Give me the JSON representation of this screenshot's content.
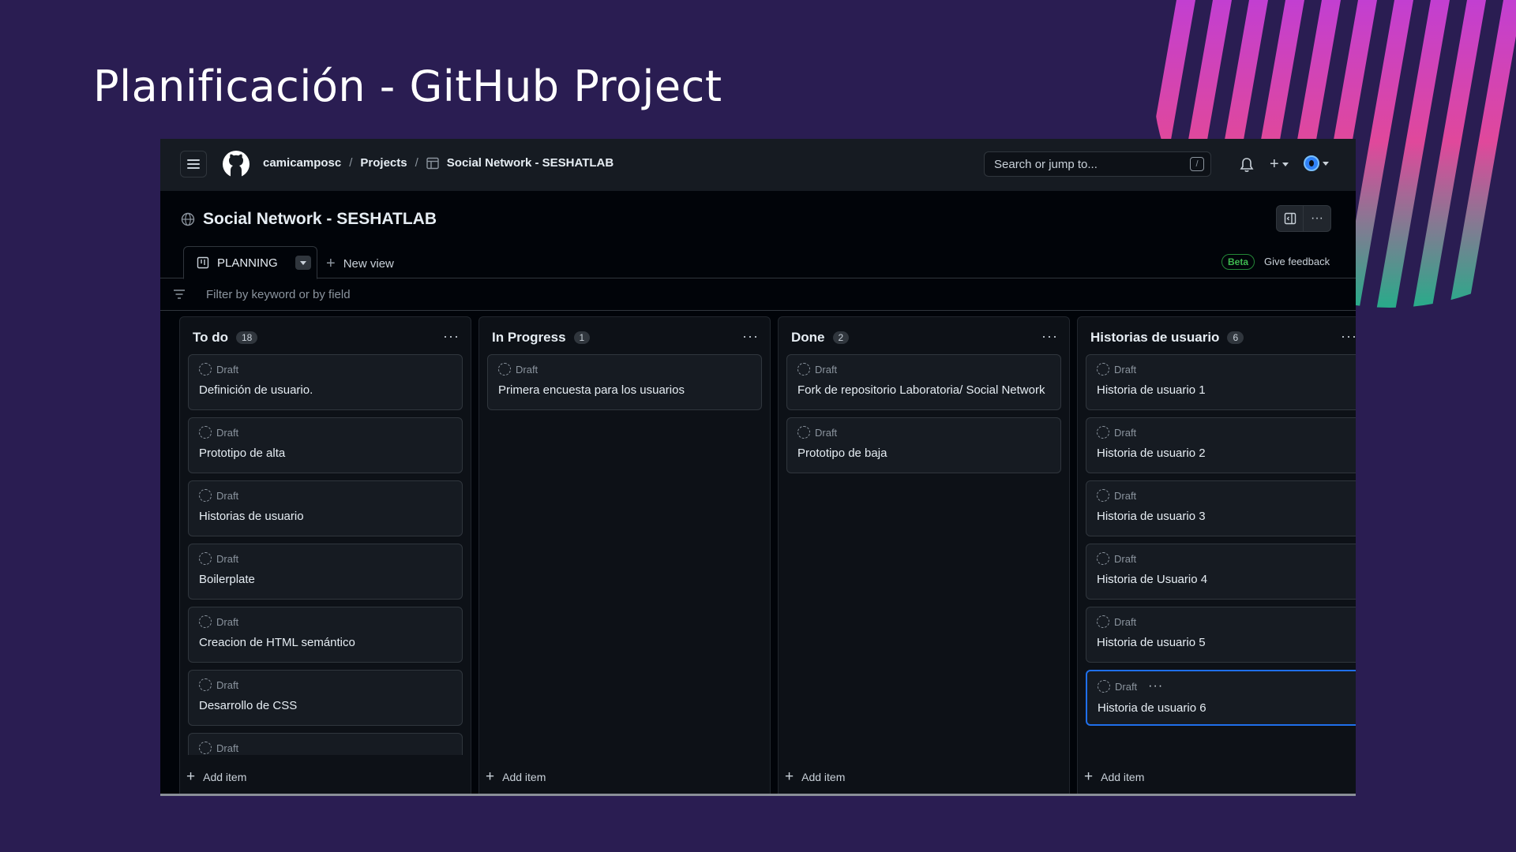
{
  "slide": {
    "title": "Planificación - GitHub Project"
  },
  "topbar": {
    "user": "camicamposc",
    "projects": "Projects",
    "project_name": "Social Network - SESHATLAB",
    "search_placeholder": "Search or jump to...",
    "search_shortcut": "/"
  },
  "project": {
    "title": "Social Network - SESHATLAB"
  },
  "tabs": {
    "active_label": "PLANNING",
    "new_view": "New view",
    "beta": "Beta",
    "feedback": "Give feedback"
  },
  "filter": {
    "placeholder": "Filter by keyword or by field"
  },
  "columns": [
    {
      "title": "To do",
      "count": "18",
      "cards": [
        {
          "status": "Draft",
          "title": "Definición de usuario."
        },
        {
          "status": "Draft",
          "title": "Prototipo de alta"
        },
        {
          "status": "Draft",
          "title": "Historias de usuario"
        },
        {
          "status": "Draft",
          "title": "Boilerplate"
        },
        {
          "status": "Draft",
          "title": "Creacion de HTML semántico"
        },
        {
          "status": "Draft",
          "title": "Desarrollo de CSS"
        },
        {
          "status": "Draft",
          "title": ""
        }
      ],
      "add_item": "Add item"
    },
    {
      "title": "In Progress",
      "count": "1",
      "cards": [
        {
          "status": "Draft",
          "title": "Primera encuesta para los usuarios"
        }
      ],
      "add_item": "Add item"
    },
    {
      "title": "Done",
      "count": "2",
      "cards": [
        {
          "status": "Draft",
          "title": "Fork de repositorio Laboratoria/ Social Network"
        },
        {
          "status": "Draft",
          "title": "Prototipo de baja"
        }
      ],
      "add_item": "Add item"
    },
    {
      "title": "Historias de usuario",
      "count": "6",
      "cards": [
        {
          "status": "Draft",
          "title": "Historia de usuario 1"
        },
        {
          "status": "Draft",
          "title": "Historia de usuario 2"
        },
        {
          "status": "Draft",
          "title": "Historia de usuario 3"
        },
        {
          "status": "Draft",
          "title": "Historia de Usuario 4"
        },
        {
          "status": "Draft",
          "title": "Historia de usuario 5"
        },
        {
          "status": "Draft",
          "title": "Historia de usuario 6",
          "selected": true
        }
      ],
      "add_item": "Add item"
    }
  ],
  "colors": {
    "slide_bg": "#2a1d52",
    "window_bg": "#010409",
    "card_bg": "#161b22",
    "accent_blue": "#1f6feb",
    "beta_green": "#3fb950"
  },
  "icons": [
    "menu-icon",
    "github-logo-icon",
    "table-icon",
    "bell-icon",
    "plus-icon",
    "globe-icon",
    "sidebar-icon",
    "kebab-icon",
    "board-icon",
    "filter-icon",
    "draft-icon"
  ]
}
